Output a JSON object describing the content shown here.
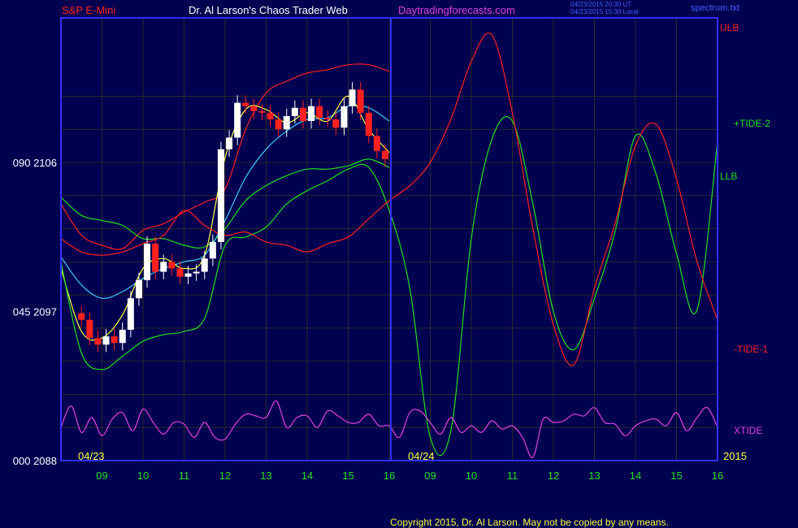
{
  "header": {
    "symbol": "S&P E-Mini",
    "title": "Dr. Al Larson's Chaos Trader Web",
    "website": "Daytradingforecasts.com",
    "timestamp_line1": "04/23/2015 20:30 UT",
    "timestamp_line2": "04/23/2015 15:30 Local",
    "filename": "spectrum.txt"
  },
  "footer": {
    "copyright": "Copyright 2015, Dr. Al Larson. May not be copied by any means."
  },
  "colors": {
    "background": "#000050",
    "plot_border": "#3030ff",
    "grid": "#2a2a2a",
    "red": "#ff2020",
    "green": "#20e020",
    "cyan": "#40c8ff",
    "yellow": "#ffff40",
    "magenta": "#e040e0",
    "white": "#ffffff"
  },
  "chart_data": {
    "type": "line",
    "x_ticks": [
      "09",
      "10",
      "11",
      "12",
      "13",
      "14",
      "15",
      "16",
      "09",
      "10",
      "11",
      "12",
      "13",
      "14",
      "15",
      "16"
    ],
    "date_labels": [
      "04/23",
      "04/24"
    ],
    "year_label": "2015",
    "y_ticks": [
      {
        "cycle": "090",
        "price": "2106"
      },
      {
        "cycle": "045",
        "price": "2097"
      },
      {
        "cycle": "000",
        "price": "2088"
      }
    ],
    "ylim": [
      2088,
      2106
    ],
    "right_labels": [
      "ULB",
      "+TIDE-2",
      "LLB",
      "-TIDE-1",
      "XTIDE"
    ],
    "day1_end_x": 16,
    "price_series": {
      "name": "S&P E-Mini 5-min",
      "x": [
        8.5,
        8.7,
        8.9,
        9.1,
        9.3,
        9.5,
        9.7,
        9.9,
        10.1,
        10.3,
        10.5,
        10.7,
        10.9,
        11.1,
        11.3,
        11.5,
        11.7,
        11.9,
        12.1,
        12.3,
        12.5,
        12.7,
        12.9,
        13.1,
        13.3,
        13.5,
        13.7,
        13.9,
        14.1,
        14.3,
        14.5,
        14.7,
        14.9,
        15.1,
        15.3,
        15.5,
        15.7,
        15.9
      ],
      "close": [
        2096.5,
        2095.4,
        2095.0,
        2095.5,
        2095.1,
        2095.9,
        2097.8,
        2098.9,
        2101.1,
        2099.4,
        2100.0,
        2099.6,
        2099.1,
        2099.3,
        2099.4,
        2100.2,
        2101.2,
        2106.8,
        2107.5,
        2109.6,
        2109.4,
        2109.1,
        2109.0,
        2108.6,
        2108.0,
        2108.8,
        2109.3,
        2108.5,
        2109.4,
        2108.7,
        2108.6,
        2108.1,
        2109.4,
        2110.4,
        2109.0,
        2107.6,
        2106.7,
        2106.2
      ]
    },
    "series": [
      {
        "name": "ULB",
        "x": [
          8.0,
          8.5,
          9.0,
          9.5,
          10.0,
          10.5,
          11.0,
          11.5,
          12.0,
          12.5,
          13.0,
          13.5,
          14.0,
          14.5,
          15.0,
          15.5,
          16.0
        ],
        "values": [
          2103.5,
          2101.6,
          2101.0,
          2100.8,
          2101.9,
          2102.3,
          2103.0,
          2103.6,
          2104.4,
          2108.0,
          2110.2,
          2110.9,
          2111.4,
          2111.6,
          2111.9,
          2111.9,
          2111.5
        ]
      },
      {
        "name": "LLB",
        "x": [
          8.0,
          8.5,
          9.0,
          9.5,
          10.0,
          10.5,
          11.0,
          11.5,
          12.0,
          12.5,
          13.0,
          13.5,
          14.0,
          14.5,
          15.0,
          15.5,
          16.0
        ],
        "values": [
          2103.9,
          2102.8,
          2102.5,
          2102.2,
          2101.4,
          2101.4,
          2101.0,
          2100.9,
          2102.0,
          2103.7,
          2104.6,
          2105.2,
          2105.6,
          2105.6,
          2105.8,
          2106.2,
          2105.7
        ]
      },
      {
        "name": "Cyan average",
        "x": [
          8.0,
          8.5,
          9.0,
          9.5,
          10.0,
          10.5,
          11.0,
          11.5,
          12.0,
          12.5,
          13.0,
          13.5,
          14.0,
          14.5,
          15.0,
          15.5,
          16.0
        ],
        "values": [
          2100.3,
          2098.6,
          2097.8,
          2098.2,
          2099.0,
          2099.6,
          2100.0,
          2100.4,
          2102.5,
          2105.1,
          2106.8,
          2107.9,
          2108.6,
          2108.7,
          2109.4,
          2109.3,
          2108.5
        ]
      },
      {
        "name": "Yellow average",
        "x": [
          8.0,
          8.5,
          9.0,
          9.5,
          10.0,
          10.5,
          11.0,
          11.5,
          12.0,
          12.5,
          13.0,
          13.5,
          14.0,
          14.5,
          15.0,
          15.5,
          16.0
        ],
        "values": [
          2099.6,
          2095.8,
          2095.4,
          2096.8,
          2099.6,
          2100.2,
          2099.6,
          2100.4,
          2106.3,
          2109.2,
          2109.2,
          2108.4,
          2109.0,
          2108.5,
          2110.0,
          2108.0,
          2106.6
        ]
      },
      {
        "name": "+TIDE-2",
        "x": [
          8.0,
          8.5,
          9.0,
          9.5,
          10.0,
          10.5,
          11.0,
          11.5,
          12.0,
          12.5,
          13.0,
          13.5,
          14.0,
          14.5,
          15.0,
          15.5,
          16.0,
          16.5,
          17.0,
          17.5,
          18.0,
          18.5,
          19.0,
          19.5,
          20.0,
          20.5,
          21.0,
          21.5,
          22.0,
          22.5,
          23.0,
          23.5,
          24.0
        ],
        "values": [
          2100.0,
          2094.5,
          2093.5,
          2094.3,
          2095.2,
          2095.6,
          2095.8,
          2096.6,
          2101.0,
          2101.5,
          2102.1,
          2103.5,
          2104.3,
          2104.9,
          2105.6,
          2105.7,
          2103.1,
          2098.4,
          2089.4,
          2089.8,
          2101.4,
          2107.4,
          2108.5,
          2103.5,
          2097.0,
          2094.7,
          2097.8,
          2101.8,
          2107.6,
          2105.3,
          2100.5,
          2097.1,
          2107.3
        ]
      },
      {
        "name": "-TIDE-1",
        "x": [
          8.0,
          8.5,
          9.0,
          9.5,
          10.0,
          10.5,
          11.0,
          11.5,
          12.0,
          12.5,
          13.0,
          13.5,
          14.0,
          14.5,
          15.0,
          15.5,
          16.0,
          16.5,
          17.0,
          17.5,
          18.0,
          18.5,
          19.0,
          19.5,
          20.0,
          20.5,
          21.0,
          21.5,
          22.0,
          22.5,
          23.0,
          23.5,
          24.0
        ],
        "values": [
          2101.4,
          2100.6,
          2100.4,
          2100.6,
          2101.1,
          2101.6,
          2103.1,
          2102.2,
          2101.6,
          2101.8,
          2101.2,
          2101.0,
          2100.6,
          2101.1,
          2101.5,
          2102.6,
          2103.7,
          2104.6,
          2106.0,
          2108.6,
          2112.1,
          2113.7,
          2109.0,
          2102.0,
          2096.2,
          2093.8,
          2098.4,
          2102.3,
          2107.0,
          2108.3,
          2105.0,
          2100.0,
          2096.5
        ]
      },
      {
        "name": "XTIDE",
        "x": [
          8.0,
          8.25,
          8.5,
          8.75,
          9.0,
          9.25,
          9.5,
          9.75,
          10.0,
          10.25,
          10.5,
          10.75,
          11.0,
          11.25,
          11.5,
          11.75,
          12.0,
          12.25,
          12.5,
          12.75,
          13.0,
          13.25,
          13.5,
          13.75,
          14.0,
          14.25,
          14.5,
          14.75,
          15.0,
          15.25,
          15.5,
          15.75,
          16.0,
          16.25,
          16.5,
          16.75,
          17.0,
          17.25,
          17.5,
          17.75,
          18.0,
          18.25,
          18.5,
          18.75,
          19.0,
          19.25,
          19.5,
          19.75,
          20.0,
          20.25,
          20.5,
          20.75,
          21.0,
          21.25,
          21.5,
          21.75,
          22.0,
          22.25,
          22.5,
          22.75,
          23.0,
          23.25,
          23.5,
          23.75,
          24.0
        ],
        "values": [
          2090.0,
          2091.3,
          2089.7,
          2090.6,
          2089.5,
          2090.5,
          2090.9,
          2089.8,
          2091.1,
          2090.3,
          2089.6,
          2090.3,
          2090.2,
          2089.4,
          2090.3,
          2089.4,
          2089.3,
          2090.2,
          2090.8,
          2090.7,
          2090.6,
          2091.6,
          2090.0,
          2090.6,
          2090.7,
          2090.0,
          2091.0,
          2090.7,
          2090.3,
          2090.3,
          2090.8,
          2090.1,
          2090.1,
          2089.4,
          2090.9,
          2091.0,
          2090.3,
          2089.6,
          2090.6,
          2089.7,
          2090.1,
          2089.7,
          2090.4,
          2089.9,
          2090.1,
          2089.4,
          2088.2,
          2090.5,
          2090.3,
          2090.4,
          2090.8,
          2090.7,
          2091.2,
          2090.3,
          2090.2,
          2089.5,
          2090.1,
          2090.4,
          2090.5,
          2090.1,
          2090.9,
          2089.8,
          2090.6,
          2091.2,
          2090.0
        ]
      }
    ]
  }
}
